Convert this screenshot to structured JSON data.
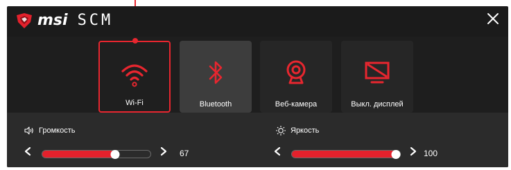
{
  "app": {
    "brand": "msi",
    "app_name": "SCM"
  },
  "colors": {
    "accent": "#e8262f",
    "panel_dark": "#1b1b1b",
    "panel_light": "#2b2b2b"
  },
  "tiles": [
    {
      "label": "Wi-Fi",
      "icon": "wifi-icon",
      "state": "active"
    },
    {
      "label": "Bluetooth",
      "icon": "bluetooth-icon",
      "state": "hover"
    },
    {
      "label": "Веб-камера",
      "icon": "webcam-icon",
      "state": "normal"
    },
    {
      "label": "Выкл. дисплей",
      "icon": "display-off-icon",
      "state": "normal"
    }
  ],
  "volume": {
    "label": "Громкость",
    "value": "67",
    "percent": 67
  },
  "brightness": {
    "label": "Яркость",
    "value": "100",
    "percent": 100
  }
}
